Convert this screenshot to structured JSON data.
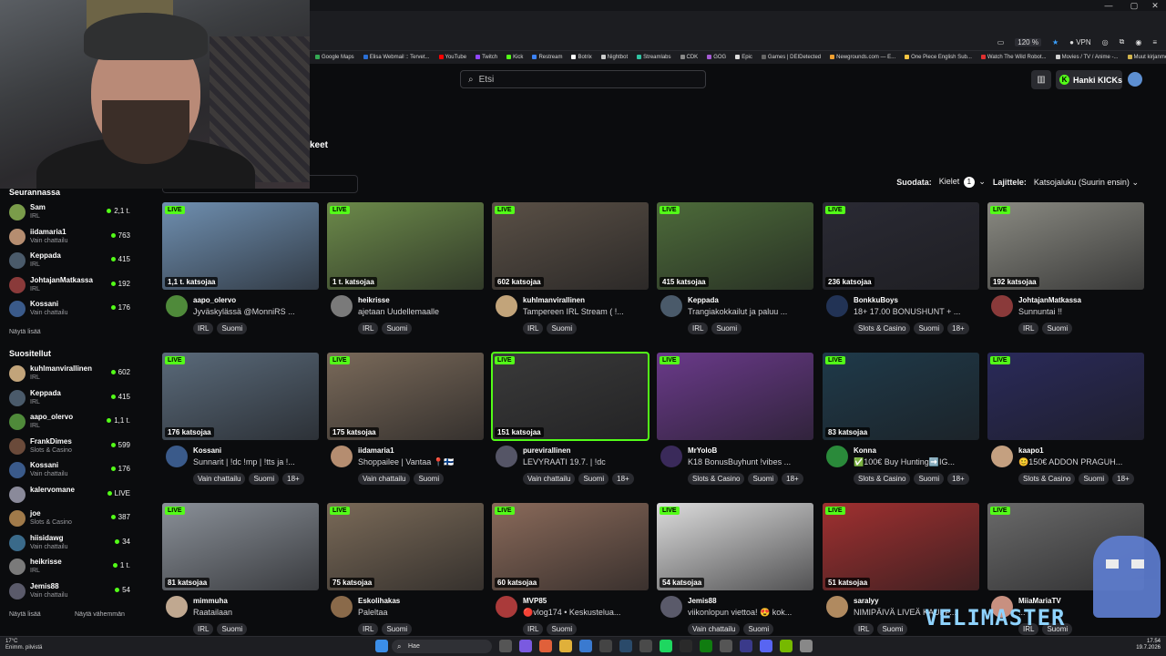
{
  "browser": {
    "zoom": "120 %",
    "vpn": "VPN",
    "bookmarks": [
      {
        "label": "Google Maps",
        "color": "#34a853"
      },
      {
        "label": "Elisa Webmail :: Tervet...",
        "color": "#2a6fd6"
      },
      {
        "label": "YouTube",
        "color": "#ff0000"
      },
      {
        "label": "Twitch",
        "color": "#9146ff"
      },
      {
        "label": "Kick",
        "color": "#53fc18"
      },
      {
        "label": "Restream",
        "color": "#3b82f6"
      },
      {
        "label": "Botrix",
        "color": "#ffffff"
      },
      {
        "label": "Nightbot",
        "color": "#cccccc"
      },
      {
        "label": "Streamlabs",
        "color": "#31c3a2"
      },
      {
        "label": "CDK",
        "color": "#888888"
      },
      {
        "label": "GOG",
        "color": "#a55bd4"
      },
      {
        "label": "Epic",
        "color": "#dddddd"
      },
      {
        "label": "Games | DEIDetected",
        "color": "#666666"
      },
      {
        "label": "Newgrounds.com — E...",
        "color": "#f0a030"
      },
      {
        "label": "One Piece English Sub...",
        "color": "#f5c542"
      },
      {
        "label": "Watch The Wild Robot...",
        "color": "#e03030"
      },
      {
        "label": "Movies / TV / Anime -...",
        "color": "#d2d2d2"
      },
      {
        "label": "Muut kirjanmerkit",
        "color": "#d2b44c"
      }
    ]
  },
  "header": {
    "search_placeholder": "Etsi",
    "kicks_label": "Hanki KICKs",
    "partial_tab": "keet"
  },
  "filters": {
    "filter_label": "Suodata:",
    "languages_label": "Kielet",
    "languages_count": "1",
    "sort_label": "Lajittele:",
    "sort_value": "Katsojaluku (Suurin ensin)"
  },
  "sidebar": {
    "following_title": "Seurannassa",
    "following": [
      {
        "name": "Sam",
        "category": "IRL",
        "viewers": "2,1 t.",
        "color": "#7a9c4a"
      },
      {
        "name": "iidamaria1",
        "category": "Vain chattailu",
        "viewers": "763",
        "color": "#b58d70"
      },
      {
        "name": "Keppada",
        "category": "IRL",
        "viewers": "415",
        "color": "#4a5a6a"
      },
      {
        "name": "JohtajanMatkassa",
        "category": "IRL",
        "viewers": "192",
        "color": "#8a3a3a"
      },
      {
        "name": "Kossani",
        "category": "Vain chattailu",
        "viewers": "176",
        "color": "#3a5a8a"
      }
    ],
    "following_more": "Näytä lisää",
    "recommended_title": "Suositellut",
    "recommended": [
      {
        "name": "kuhlmanvirallinen",
        "category": "IRL",
        "viewers": "602",
        "color": "#c2a47a"
      },
      {
        "name": "Keppada",
        "category": "IRL",
        "viewers": "415",
        "color": "#4a5a6a"
      },
      {
        "name": "aapo_olervo",
        "category": "IRL",
        "viewers": "1,1 t.",
        "color": "#4f8a3a"
      },
      {
        "name": "FrankDimes",
        "category": "Slots & Casino",
        "viewers": "599",
        "color": "#6a4a3a"
      },
      {
        "name": "Kossani",
        "category": "Vain chattailu",
        "viewers": "176",
        "color": "#3a5a8a"
      },
      {
        "name": "kalervomane",
        "category": "",
        "viewers": "LIVE",
        "color": "#8a8a9a"
      },
      {
        "name": "joe",
        "category": "Slots & Casino",
        "viewers": "387",
        "color": "#a07a4a"
      },
      {
        "name": "hiisidawg",
        "category": "Vain chattailu",
        "viewers": "34",
        "color": "#3a6a8a"
      },
      {
        "name": "heikrisse",
        "category": "IRL",
        "viewers": "1 t.",
        "color": "#7a7a7a"
      },
      {
        "name": "Jemis88",
        "category": "Vain chattailu",
        "viewers": "54",
        "color": "#5a5a6a"
      }
    ],
    "recommended_more": "Näytä lisää",
    "recommended_less": "Näytä vähemmän"
  },
  "live_label": "LIVE",
  "cards": [
    {
      "viewers": "1,1 t. katsojaa",
      "name": "aapo_olervo",
      "title": "Jyväskylässä @MonniRS ...",
      "tags": [
        "IRL",
        "Suomi"
      ],
      "thumb": "#6f8fb0",
      "av": "#4f8a3a"
    },
    {
      "viewers": "1 t. katsojaa",
      "name": "heikrisse",
      "title": "ajetaan Uudellemaalle",
      "tags": [
        "IRL",
        "Suomi"
      ],
      "thumb": "#6c8a4a",
      "av": "#7a7a7a"
    },
    {
      "viewers": "602 katsojaa",
      "name": "kuhlmanvirallinen",
      "title": "Tampereen IRL Stream ( !...",
      "tags": [
        "IRL",
        "Suomi"
      ],
      "thumb": "#5a5046",
      "av": "#c2a47a"
    },
    {
      "viewers": "415 katsojaa",
      "name": "Keppada",
      "title": "Trangiakokkailut ja paluu ...",
      "tags": [
        "IRL",
        "Suomi"
      ],
      "thumb": "#4d6b3a",
      "av": "#4a5a6a"
    },
    {
      "viewers": "236 katsojaa",
      "name": "BonkkuBoys",
      "title": "18+ 17.00 BONUSHUNT + ...",
      "tags": [
        "Slots & Casino",
        "Suomi",
        "18+"
      ],
      "thumb": "#2a2a34",
      "av": "#223355"
    },
    {
      "viewers": "192 katsojaa",
      "name": "JohtajanMatkassa",
      "title": "Sunnuntai !!",
      "tags": [
        "IRL",
        "Suomi"
      ],
      "thumb": "#8a8a82",
      "av": "#8a3a3a"
    },
    {
      "viewers": "176 katsojaa",
      "name": "Kossani",
      "title": "Sunnarit | !dc !mp | !tts ja !...",
      "tags": [
        "Vain chattailu",
        "Suomi",
        "18+"
      ],
      "thumb": "#5a6a7a",
      "av": "#3a5a8a"
    },
    {
      "viewers": "175 katsojaa",
      "name": "iidamaria1",
      "title": "Shoppailee | Vantaa 📍🇫🇮",
      "tags": [
        "Vain chattailu",
        "Suomi"
      ],
      "thumb": "#7a6a5a",
      "av": "#b58d70"
    },
    {
      "viewers": "151 katsojaa",
      "name": "purevirallinen",
      "title": "LEVYRAATI 19.7. | !dc",
      "tags": [
        "Vain chattailu",
        "Suomi",
        "18+"
      ],
      "thumb": "#3a3a3a",
      "av": "#555566"
    },
    {
      "viewers": "",
      "name": "MrYoloB",
      "title": "K18 BonusBuyhunt !vibes ...",
      "tags": [
        "Slots & Casino",
        "Suomi",
        "18+"
      ],
      "thumb": "#6a3a8a",
      "av": "#3a2a5a"
    },
    {
      "viewers": "83 katsojaa",
      "name": "Konna",
      "title": "✅100€ Buy Hunting➡️IG...",
      "tags": [
        "Slots & Casino",
        "Suomi",
        "18+"
      ],
      "thumb": "#1f3a4a",
      "av": "#2a8a3a"
    },
    {
      "viewers": "",
      "name": "kaapo1",
      "title": "😊150€ ADDON PRAGUH...",
      "tags": [
        "Slots & Casino",
        "Suomi",
        "18+"
      ],
      "thumb": "#2a2a5a",
      "av": "#c4a080"
    },
    {
      "viewers": "81 katsojaa",
      "name": "mimmuha",
      "title": "Raatailaan",
      "tags": [
        "IRL",
        "Suomi"
      ],
      "thumb": "#8a9098",
      "av": "#c0a890"
    },
    {
      "viewers": "75 katsojaa",
      "name": "Eskolihakas",
      "title": "Paleltaa",
      "tags": [
        "IRL",
        "Suomi"
      ],
      "thumb": "#7a6a58",
      "av": "#8a6a4a"
    },
    {
      "viewers": "60 katsojaa",
      "name": "MVP85",
      "title": "🔴vlog174 • Keskustelua...",
      "tags": [
        "IRL",
        "Suomi"
      ],
      "thumb": "#8a6a5a",
      "av": "#aa3a3a"
    },
    {
      "viewers": "54 katsojaa",
      "name": "Jemis88",
      "title": "viikonlopun viettoa! 😍 kok...",
      "tags": [
        "Vain chattailu",
        "Suomi"
      ],
      "thumb": "#dcdcdc",
      "av": "#5a5a6a"
    },
    {
      "viewers": "51 katsojaa",
      "name": "saralyy",
      "title": "NIMIPÄIVÄ LIVEÄ KAUPP...",
      "tags": [
        "IRL",
        "Suomi"
      ],
      "thumb": "#a03030",
      "av": "#b08a60"
    },
    {
      "viewers": "",
      "name": "MiiaMariaTV",
      "title": "...",
      "tags": [
        "IRL",
        "Suomi"
      ],
      "thumb": "#6a6a6a",
      "av": "#c89080"
    }
  ],
  "taskbar": {
    "temp": "17°C",
    "weather": "Enimm. pilvistä",
    "search": "Hae",
    "time": "17.54",
    "date": "19.7.2026"
  },
  "overlay": {
    "watermark": "VELIMASTER"
  }
}
